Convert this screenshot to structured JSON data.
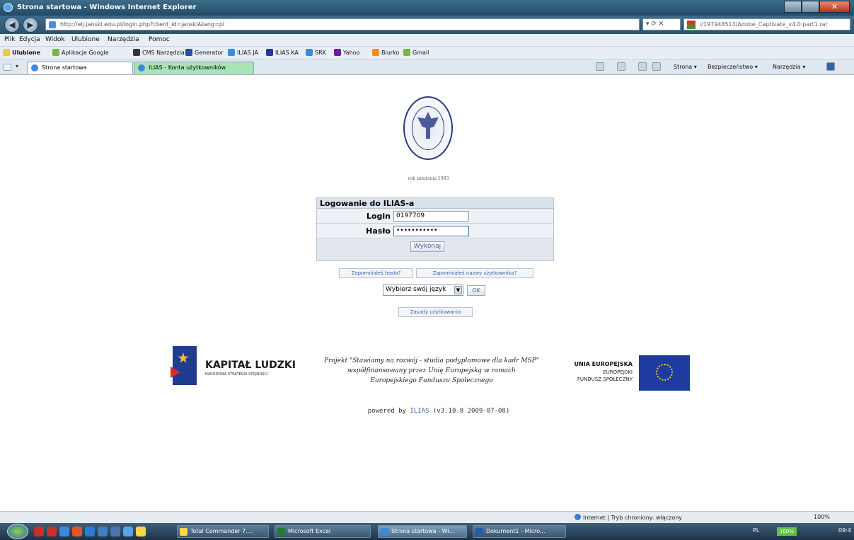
{
  "window": {
    "title": "Strona startowa - Windows Internet Explorer"
  },
  "address_bar": {
    "url": "http://elj.janski.edu.pl/login.php?client_id=janski&lang=pl",
    "search_text": "i/197948513/Adobe_Captivate_v4.0.part1.rar"
  },
  "menu": {
    "items": [
      "Plik",
      "Edycja",
      "Widok",
      "Ulubione",
      "Narzędzia",
      "Pomoc"
    ]
  },
  "favorites": {
    "label": "Ulubione",
    "items": [
      "Aplikacje Google",
      "CMS Narzędzia",
      "Generator",
      "ILIAS JA",
      "ILIAS KA",
      "SRK",
      "Yahoo",
      "Biurko",
      "Gmail"
    ]
  },
  "tabs": [
    {
      "label": "Strona startowa"
    },
    {
      "label": "ILIAS - Konta użytkowników"
    }
  ],
  "command_bar": {
    "items": [
      "Strona ▾",
      "Bezpieczeństwo ▾",
      "Narzędzia ▾"
    ]
  },
  "page": {
    "emblem_caption": "rok założenia 1993",
    "login": {
      "heading": "Logowanie do ILIAS-a",
      "login_label": "Login",
      "login_value": "0197709",
      "password_label": "Hasło",
      "password_value": "•••••••••••",
      "submit_label": "Wykonaj"
    },
    "forgot_password": "Zapomniałeś hasła?",
    "forgot_username": "Zapomniałeś nazwy użytkownika?",
    "language_select": "Wybierz swój język",
    "ok_label": "OK",
    "terms_link": "Zasady użytkowania",
    "kapital_title": "KAPITAŁ LUDZKI",
    "kapital_sub": "NARODOWA STRATEGIA SPÓJNOŚCI",
    "project_line1": "Projekt \"Stawiamy na rozwój - studia podyplomowe dla kadr MSP\"",
    "project_line2": "współfinansowany przez Unię Europejską w ramach",
    "project_line3": "Europejskiego Funduszu Społecznego",
    "ue_title": "UNIA EUROPEJSKA",
    "ue_line2": "EUROPEJSKI",
    "ue_line3": "FUNDUSZ SPOŁECZNY",
    "powered_prefix": "powered by",
    "powered_link": "ILIAS",
    "powered_version": "(v3.10.8 2009-07-08)"
  },
  "status_bar": {
    "zone": "Internet | Tryb chroniony: włączony",
    "zoom": "100%"
  },
  "taskbar": {
    "tasks": [
      "Total Commander 7....",
      "Microsoft Excel",
      "Strona startowa - Wi...",
      "Dokument1 - Micro..."
    ],
    "lang": "PL",
    "battery": "100%",
    "clock": "09:4"
  }
}
